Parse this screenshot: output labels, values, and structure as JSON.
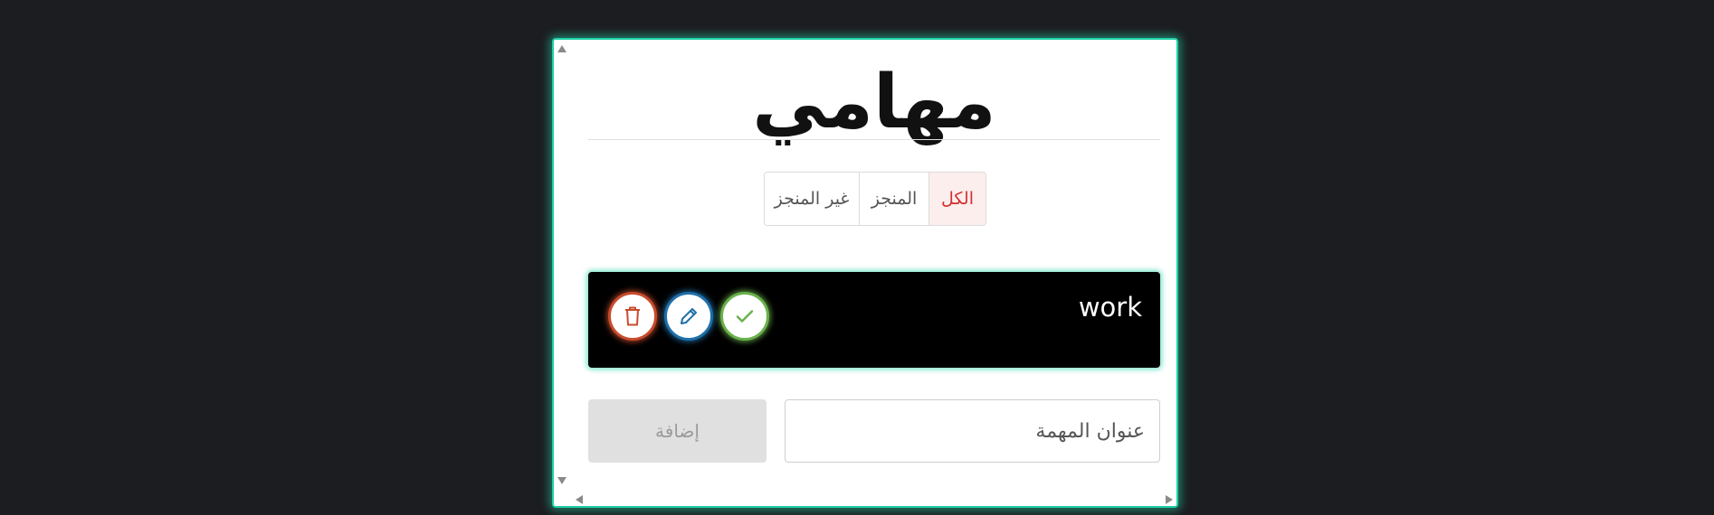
{
  "page": {
    "title": "مهامي"
  },
  "filters": [
    {
      "label": "الكل",
      "active": true
    },
    {
      "label": "المنجز",
      "active": false
    },
    {
      "label": "غير المنجز",
      "active": false
    }
  ],
  "tasks": [
    {
      "title": "work",
      "actions": [
        "done-check-icon",
        "edit-pencil-icon",
        "delete-trash-icon"
      ]
    }
  ],
  "new_task": {
    "placeholder": "عنوان المهمة",
    "value": "",
    "add_label": "إضافة"
  },
  "colors": {
    "accent_glow": "#1fd1a6",
    "delete": "#c84b2c",
    "edit": "#1e6fa8",
    "done": "#6ab04c",
    "active_filter": "#d32f2f"
  }
}
